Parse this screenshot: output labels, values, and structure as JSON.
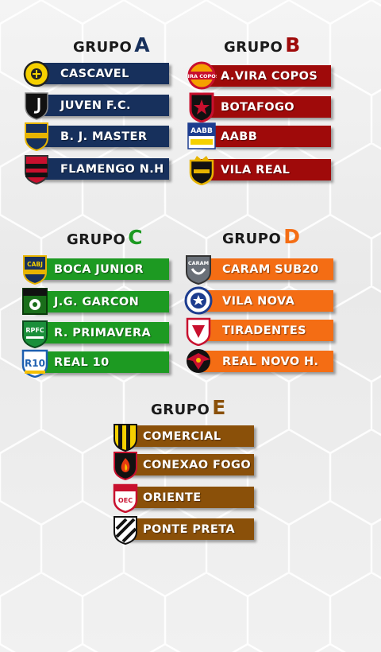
{
  "colors": {
    "A": "#17305c",
    "B": "#9f0a0a",
    "C": "#1d9a22",
    "D": "#f46d14",
    "E": "#8a5009"
  },
  "groups": {
    "A": {
      "word": "GRUPO",
      "letter": "A",
      "teams": [
        {
          "name": "CASCAVEL",
          "badge": "yellow-round-crest-icon"
        },
        {
          "name": "JUVEN F.C.",
          "badge": "black-j-shield-icon"
        },
        {
          "name": "B. J. MASTER",
          "badge": "navy-gold-shield-icon"
        },
        {
          "name": "FLAMENGO N.H",
          "badge": "red-black-shield-icon"
        }
      ]
    },
    "B": {
      "word": "GRUPO",
      "letter": "B",
      "teams": [
        {
          "name": "A.VIRA COPOS",
          "badge": "vira-copos-crest-icon",
          "badge_text": "VIRA COPOS"
        },
        {
          "name": "BOTAFOGO",
          "badge": "red-black-star-shield-icon"
        },
        {
          "name": "AABB",
          "badge": "aabb-logo-icon",
          "badge_text": "AABB"
        },
        {
          "name": "VILA REAL",
          "badge": "vila-real-crown-crest-icon"
        }
      ]
    },
    "C": {
      "word": "GRUPO",
      "letter": "C",
      "teams": [
        {
          "name": "BOCA JUNIOR",
          "badge": "cabj-shield-icon",
          "badge_text": "CABJ"
        },
        {
          "name": "J.G. GARCON",
          "badge": "green-square-crest-icon"
        },
        {
          "name": "R. PRIMAVERA",
          "badge": "rpfc-green-shield-icon",
          "badge_text": "RPFC"
        },
        {
          "name": "REAL 10",
          "badge": "real-10-shield-icon",
          "badge_text": "R10"
        }
      ]
    },
    "D": {
      "word": "GRUPO",
      "letter": "D",
      "teams": [
        {
          "name": "CARAM SUB20",
          "badge": "caram-gray-shield-icon",
          "badge_text": "CARAM"
        },
        {
          "name": "VILA NOVA",
          "badge": "vila-nova-round-crest-icon"
        },
        {
          "name": "TIRADENTES",
          "badge": "tiradentes-crest-icon"
        },
        {
          "name": "REAL NOVO H.",
          "badge": "red-black-eagle-crest-icon"
        }
      ]
    },
    "E": {
      "word": "GRUPO",
      "letter": "E",
      "teams": [
        {
          "name": "COMERCIAL",
          "badge": "yellow-black-stripes-shield-icon"
        },
        {
          "name": "CONEXAO FOGO",
          "badge": "flame-shield-icon"
        },
        {
          "name": "ORIENTE",
          "badge": "oec-red-shield-icon",
          "badge_text": "OEC"
        },
        {
          "name": "PONTE PRETA",
          "badge": "black-white-stripes-shield-icon"
        }
      ]
    }
  }
}
